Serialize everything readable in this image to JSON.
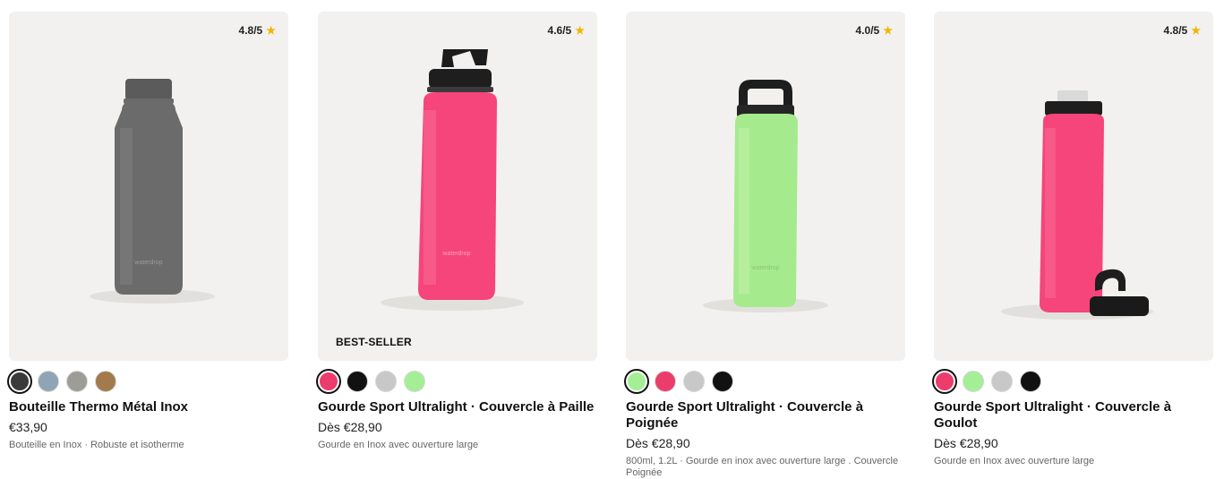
{
  "products": [
    {
      "rating": "4.8/5",
      "badge": "",
      "swatches": [
        "#3a3a3a",
        "#8fa4b5",
        "#9e9c97",
        "#a27a4c"
      ],
      "title": "Bouteille Thermo Métal Inox",
      "price": "€33,90",
      "description": "Bouteille en Inox · Robuste et isotherme"
    },
    {
      "rating": "4.6/5",
      "badge": "BEST-SELLER",
      "swatches": [
        "#ec3c6b",
        "#111111",
        "#c8c8c8",
        "#a4ef96"
      ],
      "title": "Gourde Sport Ultralight · Couvercle à Paille",
      "price": "Dès €28,90",
      "description": "Gourde en Inox avec ouverture large"
    },
    {
      "rating": "4.0/5",
      "badge": "",
      "swatches": [
        "#a4ef96",
        "#ec3c6b",
        "#c8c8c8",
        "#111111"
      ],
      "title": "Gourde Sport Ultralight · Couvercle à Poignée",
      "price": "Dès €28,90",
      "description": "800ml, 1.2L · Gourde en inox avec ouverture large . Couvercle Poignée"
    },
    {
      "rating": "4.8/5",
      "badge": "",
      "swatches": [
        "#ec3c6b",
        "#a4ef96",
        "#c8c8c8",
        "#111111"
      ],
      "title": "Gourde Sport Ultralight · Couvercle à Goulot",
      "price": "Dès €28,90",
      "description": "Gourde en Inox avec ouverture large"
    }
  ],
  "colors": {
    "star": "#f5b400",
    "card_background": "#f2f1ef"
  }
}
